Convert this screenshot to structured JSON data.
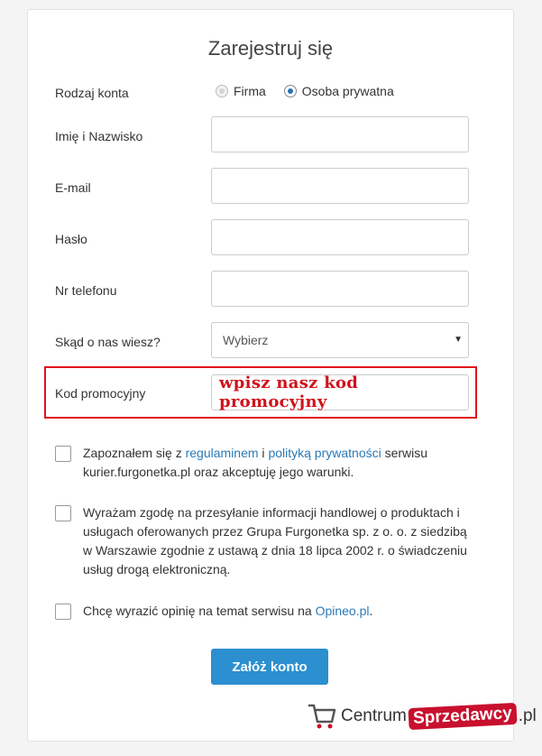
{
  "form": {
    "title": "Zarejestruj się",
    "account_type": {
      "label": "Rodzaj konta",
      "options": [
        "Firma",
        "Osoba prywatna"
      ],
      "selected": "Osoba prywatna"
    },
    "fields": {
      "name_label": "Imię i Nazwisko",
      "email_label": "E-mail",
      "password_label": "Hasło",
      "phone_label": "Nr telefonu",
      "source_label": "Skąd o nas wiesz?",
      "source_value": "Wybierz",
      "promo_label": "Kod promocyjny",
      "promo_value": "wpisz nasz kod promocyjny"
    },
    "consents": {
      "terms_prefix": "Zapoznałem się z ",
      "terms_link": "regulaminem",
      "terms_and": " i ",
      "privacy_link": "polityką prywatności",
      "terms_suffix": " serwisu kurier.furgonetka.pl oraz akceptuję jego warunki.",
      "marketing": "Wyrażam zgodę na przesyłanie informacji handlowej o produktach i usługach oferowanych przez Grupa Furgonetka sp. z o. o. z siedzibą w Warszawie zgodnie z ustawą z dnia 18 lipca 2002 r. o świadczeniu usług drogą elektroniczną.",
      "opineo_prefix": "Chcę wyrazić opinię na temat serwisu na ",
      "opineo_link": "Opineo.pl",
      "opineo_suffix": "."
    },
    "submit_label": "Załóż konto"
  },
  "watermark": {
    "prefix": "Centrum",
    "badge": "Sprzedawcy",
    "suffix": ".pl",
    "icon": "shopping-cart-icon"
  },
  "colors": {
    "accent": "#2b8fd0",
    "link": "#2a7ab8",
    "highlight": "#e0121b"
  }
}
